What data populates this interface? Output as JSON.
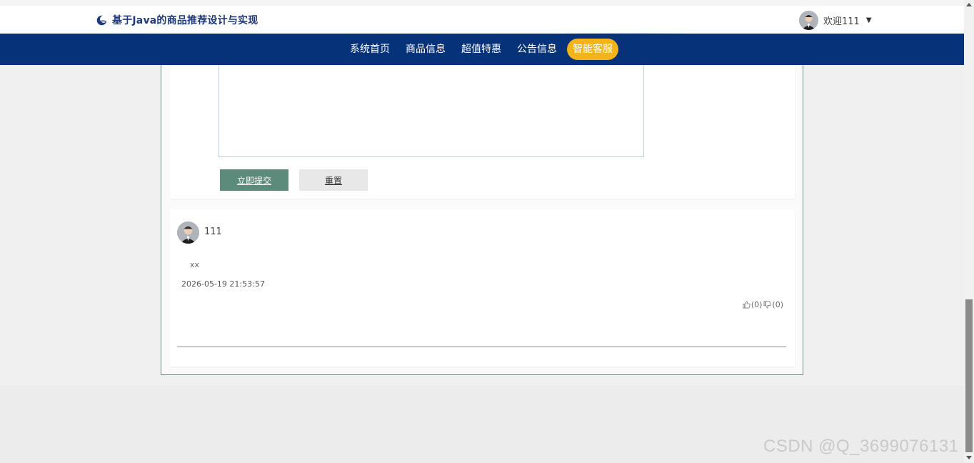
{
  "header": {
    "title": "基于Java的商品推荐设计与实现",
    "logo_icon": "moon-swirl-icon",
    "user_greeting": "欢迎111",
    "caret_icon": "caret-down-icon"
  },
  "nav": {
    "items": [
      {
        "label": "系统首页",
        "active": false
      },
      {
        "label": "商品信息",
        "active": false
      },
      {
        "label": "超值特惠",
        "active": false
      },
      {
        "label": "公告信息",
        "active": false
      },
      {
        "label": "智能客服",
        "active": true
      }
    ],
    "accent": "#f2b418",
    "bar_color": "#06327a"
  },
  "form": {
    "textarea_value": "",
    "submit_label": "立即提交",
    "reset_label": "重置"
  },
  "comment": {
    "username": "111",
    "content": "xx",
    "time": "2026-05-19 21:53:57",
    "like_label": "(0)",
    "dislike_label": "(0)"
  },
  "watermark": "CSDN @Q_3699076131"
}
